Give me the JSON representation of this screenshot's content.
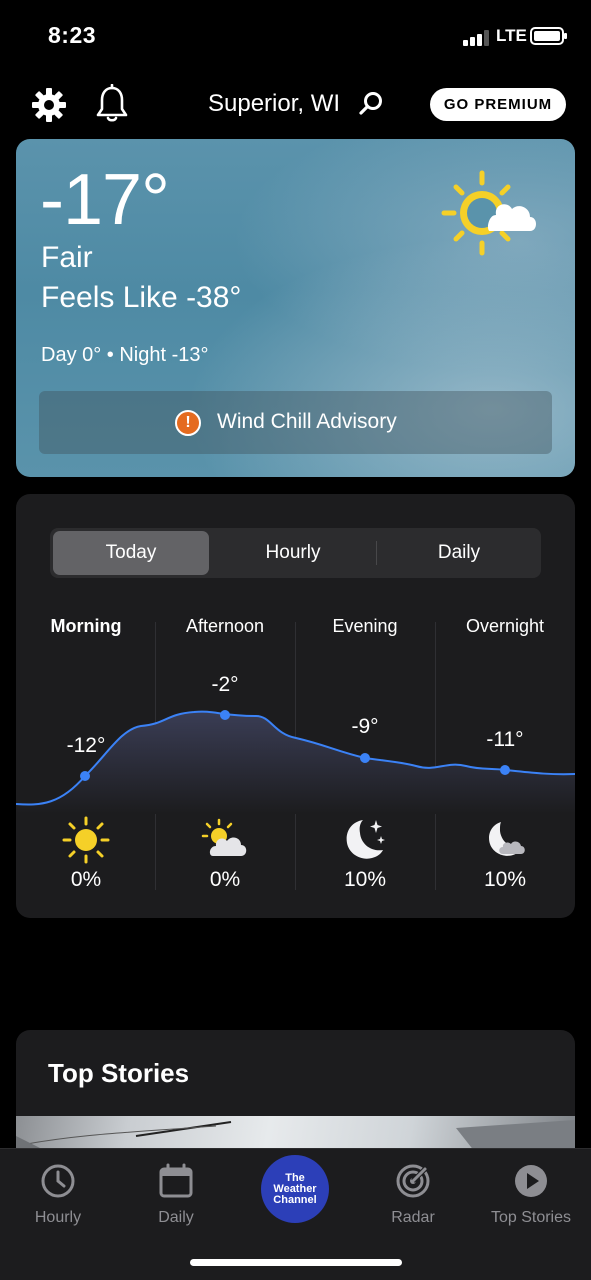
{
  "status_bar": {
    "time": "8:23",
    "network": "LTE"
  },
  "header": {
    "location": "Superior, WI",
    "premium_label": "GO PREMIUM"
  },
  "current": {
    "temperature": "-17°",
    "condition": "Fair",
    "feels_like": "Feels Like -38°",
    "day_night": "Day 0° • Night -13°",
    "advisory": "Wind Chill Advisory",
    "advisory_icon": "!",
    "icon": "sun-cloud-icon"
  },
  "forecast": {
    "tabs": [
      "Today",
      "Hourly",
      "Daily"
    ],
    "active_tab": "Today",
    "periods": [
      {
        "name": "Morning",
        "temp": "-12°",
        "precip": "0%",
        "icon": "sunny-icon"
      },
      {
        "name": "Afternoon",
        "temp": "-2°",
        "precip": "0%",
        "icon": "partly-cloudy-icon"
      },
      {
        "name": "Evening",
        "temp": "-9°",
        "precip": "10%",
        "icon": "clear-night-icon"
      },
      {
        "name": "Overnight",
        "temp": "-11°",
        "precip": "10%",
        "icon": "night-cloud-icon"
      }
    ]
  },
  "top_stories": {
    "title": "Top Stories"
  },
  "tab_bar": {
    "items": [
      "Hourly",
      "Daily",
      "Radar",
      "Top Stories"
    ],
    "logo_lines": [
      "The",
      "Weather",
      "Channel"
    ]
  },
  "colors": {
    "accent": "#3b82f6",
    "premium_bg": "#ffffff",
    "advisory": "#e56b1f",
    "twc_blue": "#2c3fb8"
  }
}
